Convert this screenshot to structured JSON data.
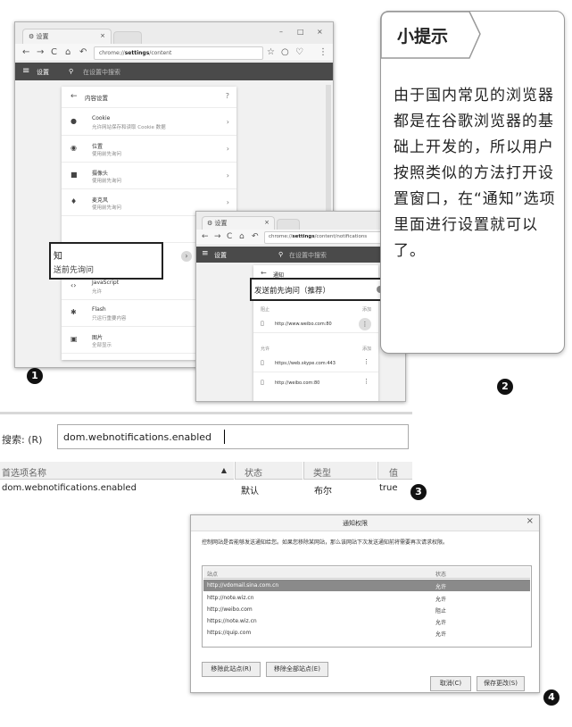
{
  "screenshot1": {
    "tab_title": "设置",
    "window_controls": [
      "–",
      "□",
      "×"
    ],
    "url_prefix": "chrome://",
    "url_bold": "settings",
    "url_suffix": "/content",
    "bar_title": "设置",
    "search_placeholder": "在设置中搜索",
    "content_header": "内容设置",
    "rows": [
      {
        "icon": "cookie-icon",
        "glyph": "●",
        "title": "Cookie",
        "sub": "允许网站保存和读取 Cookie 数据"
      },
      {
        "icon": "location-icon",
        "glyph": "◉",
        "title": "位置",
        "sub": "使用前先询问"
      },
      {
        "icon": "camera-icon",
        "glyph": "■",
        "title": "摄像头",
        "sub": "使用前先询问"
      },
      {
        "icon": "mic-icon",
        "glyph": "♦",
        "title": "麦克风",
        "sub": "使用前先询问"
      },
      {
        "icon": "javascript-icon",
        "glyph": "‹›",
        "title": "JavaScript",
        "sub": "允许"
      },
      {
        "icon": "flash-icon",
        "glyph": "✱",
        "title": "Flash",
        "sub": "只运行重要内容"
      },
      {
        "icon": "image-icon",
        "glyph": "▣",
        "title": "图片",
        "sub": "全部显示"
      }
    ],
    "highlight_title": "知",
    "highlight_sub": "送前先询问",
    "badge": "1"
  },
  "screenshot2": {
    "tab_title": "设置",
    "url_prefix": "chrome://",
    "url_bold": "settings",
    "url_suffix": "/content/notifications",
    "bar_title": "设置",
    "search_placeholder": "在设置中搜索",
    "back_label": "通知",
    "highlight_label": "发送前先询问（推荐）",
    "block_header": "阻止",
    "block_add": "添加",
    "block_sites": [
      "http://www.weibo.com:80"
    ],
    "allow_header": "允许",
    "allow_add": "添加",
    "allow_sites": [
      "https://web.skype.com:443",
      "http://weibo.com:80"
    ],
    "badge": "2"
  },
  "tips": {
    "title": "小提示",
    "text": "由于国内常见的浏览器都是在谷歌浏览器的基础上开发的，所以用户按照类似的方法打开设置窗口，在“通知”选项里面进行设置就可以了。"
  },
  "about_config": {
    "search_label": "搜索: (R)",
    "search_value": "dom.webnotifications.enabled",
    "columns": [
      "首选项名称",
      "状态",
      "类型",
      "值"
    ],
    "row": {
      "name": "dom.webnotifications.enabled",
      "status": "默认",
      "type": "布尔",
      "value": "true"
    },
    "badge": "3"
  },
  "dialog": {
    "title": "通知权限",
    "close": "×",
    "description": "控制网站是否能够发送通知给您。如果您移除某网站，那么该网站下次发送通知前将需要再次请求权限。",
    "col_site": "站点",
    "col_status": "状态",
    "sites": [
      {
        "site": "http://vdomail.sina.com.cn",
        "status": "允许",
        "selected": true
      },
      {
        "site": "http://note.wiz.cn",
        "status": "允许",
        "selected": false
      },
      {
        "site": "http://weibo.com",
        "status": "阻止",
        "selected": false
      },
      {
        "site": "https://note.wiz.cn",
        "status": "允许",
        "selected": false
      },
      {
        "site": "https://quip.com",
        "status": "允许",
        "selected": false
      }
    ],
    "remove_site": "移除此站点(R)",
    "remove_all": "移除全部站点(E)",
    "cancel": "取消(C)",
    "save": "保存更改(S)",
    "badge": "4"
  }
}
